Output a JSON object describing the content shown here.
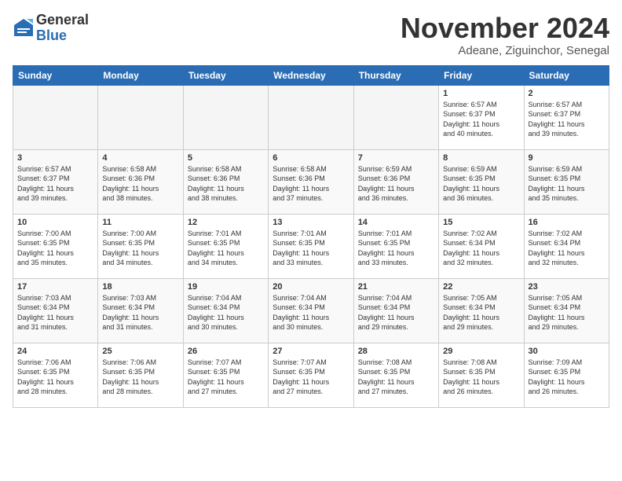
{
  "logo": {
    "general": "General",
    "blue": "Blue"
  },
  "title": "November 2024",
  "location": "Adeane, Ziguinchor, Senegal",
  "weekdays": [
    "Sunday",
    "Monday",
    "Tuesday",
    "Wednesday",
    "Thursday",
    "Friday",
    "Saturday"
  ],
  "weeks": [
    [
      {
        "day": "",
        "info": ""
      },
      {
        "day": "",
        "info": ""
      },
      {
        "day": "",
        "info": ""
      },
      {
        "day": "",
        "info": ""
      },
      {
        "day": "",
        "info": ""
      },
      {
        "day": "1",
        "info": "Sunrise: 6:57 AM\nSunset: 6:37 PM\nDaylight: 11 hours\nand 40 minutes."
      },
      {
        "day": "2",
        "info": "Sunrise: 6:57 AM\nSunset: 6:37 PM\nDaylight: 11 hours\nand 39 minutes."
      }
    ],
    [
      {
        "day": "3",
        "info": "Sunrise: 6:57 AM\nSunset: 6:37 PM\nDaylight: 11 hours\nand 39 minutes."
      },
      {
        "day": "4",
        "info": "Sunrise: 6:58 AM\nSunset: 6:36 PM\nDaylight: 11 hours\nand 38 minutes."
      },
      {
        "day": "5",
        "info": "Sunrise: 6:58 AM\nSunset: 6:36 PM\nDaylight: 11 hours\nand 38 minutes."
      },
      {
        "day": "6",
        "info": "Sunrise: 6:58 AM\nSunset: 6:36 PM\nDaylight: 11 hours\nand 37 minutes."
      },
      {
        "day": "7",
        "info": "Sunrise: 6:59 AM\nSunset: 6:36 PM\nDaylight: 11 hours\nand 36 minutes."
      },
      {
        "day": "8",
        "info": "Sunrise: 6:59 AM\nSunset: 6:35 PM\nDaylight: 11 hours\nand 36 minutes."
      },
      {
        "day": "9",
        "info": "Sunrise: 6:59 AM\nSunset: 6:35 PM\nDaylight: 11 hours\nand 35 minutes."
      }
    ],
    [
      {
        "day": "10",
        "info": "Sunrise: 7:00 AM\nSunset: 6:35 PM\nDaylight: 11 hours\nand 35 minutes."
      },
      {
        "day": "11",
        "info": "Sunrise: 7:00 AM\nSunset: 6:35 PM\nDaylight: 11 hours\nand 34 minutes."
      },
      {
        "day": "12",
        "info": "Sunrise: 7:01 AM\nSunset: 6:35 PM\nDaylight: 11 hours\nand 34 minutes."
      },
      {
        "day": "13",
        "info": "Sunrise: 7:01 AM\nSunset: 6:35 PM\nDaylight: 11 hours\nand 33 minutes."
      },
      {
        "day": "14",
        "info": "Sunrise: 7:01 AM\nSunset: 6:35 PM\nDaylight: 11 hours\nand 33 minutes."
      },
      {
        "day": "15",
        "info": "Sunrise: 7:02 AM\nSunset: 6:34 PM\nDaylight: 11 hours\nand 32 minutes."
      },
      {
        "day": "16",
        "info": "Sunrise: 7:02 AM\nSunset: 6:34 PM\nDaylight: 11 hours\nand 32 minutes."
      }
    ],
    [
      {
        "day": "17",
        "info": "Sunrise: 7:03 AM\nSunset: 6:34 PM\nDaylight: 11 hours\nand 31 minutes."
      },
      {
        "day": "18",
        "info": "Sunrise: 7:03 AM\nSunset: 6:34 PM\nDaylight: 11 hours\nand 31 minutes."
      },
      {
        "day": "19",
        "info": "Sunrise: 7:04 AM\nSunset: 6:34 PM\nDaylight: 11 hours\nand 30 minutes."
      },
      {
        "day": "20",
        "info": "Sunrise: 7:04 AM\nSunset: 6:34 PM\nDaylight: 11 hours\nand 30 minutes."
      },
      {
        "day": "21",
        "info": "Sunrise: 7:04 AM\nSunset: 6:34 PM\nDaylight: 11 hours\nand 29 minutes."
      },
      {
        "day": "22",
        "info": "Sunrise: 7:05 AM\nSunset: 6:34 PM\nDaylight: 11 hours\nand 29 minutes."
      },
      {
        "day": "23",
        "info": "Sunrise: 7:05 AM\nSunset: 6:34 PM\nDaylight: 11 hours\nand 29 minutes."
      }
    ],
    [
      {
        "day": "24",
        "info": "Sunrise: 7:06 AM\nSunset: 6:35 PM\nDaylight: 11 hours\nand 28 minutes."
      },
      {
        "day": "25",
        "info": "Sunrise: 7:06 AM\nSunset: 6:35 PM\nDaylight: 11 hours\nand 28 minutes."
      },
      {
        "day": "26",
        "info": "Sunrise: 7:07 AM\nSunset: 6:35 PM\nDaylight: 11 hours\nand 27 minutes."
      },
      {
        "day": "27",
        "info": "Sunrise: 7:07 AM\nSunset: 6:35 PM\nDaylight: 11 hours\nand 27 minutes."
      },
      {
        "day": "28",
        "info": "Sunrise: 7:08 AM\nSunset: 6:35 PM\nDaylight: 11 hours\nand 27 minutes."
      },
      {
        "day": "29",
        "info": "Sunrise: 7:08 AM\nSunset: 6:35 PM\nDaylight: 11 hours\nand 26 minutes."
      },
      {
        "day": "30",
        "info": "Sunrise: 7:09 AM\nSunset: 6:35 PM\nDaylight: 11 hours\nand 26 minutes."
      }
    ]
  ]
}
